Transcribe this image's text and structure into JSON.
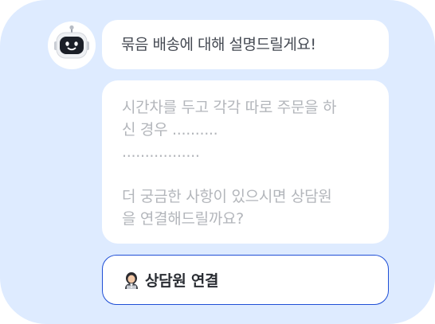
{
  "chat": {
    "bot_avatar_icon": "robot-icon",
    "greeting": "묶음 배송에 대해 설명드릴게요!",
    "body_lines_1": [
      "시간차를 두고 각각 따로 주문을 하",
      "신 경우 ..........",
      "................."
    ],
    "body_lines_2": [
      "더 궁금한 사항이 있으시면 상담원",
      "을 연결해드릴까요?"
    ]
  },
  "action": {
    "icon": "agent-icon",
    "label": "상담원 연결"
  },
  "colors": {
    "panel_background": "#deebff",
    "bubble_background": "#ffffff",
    "button_border": "#1f4fd6",
    "greeting_text": "#454a53",
    "body_text": "#b3b6bb"
  }
}
